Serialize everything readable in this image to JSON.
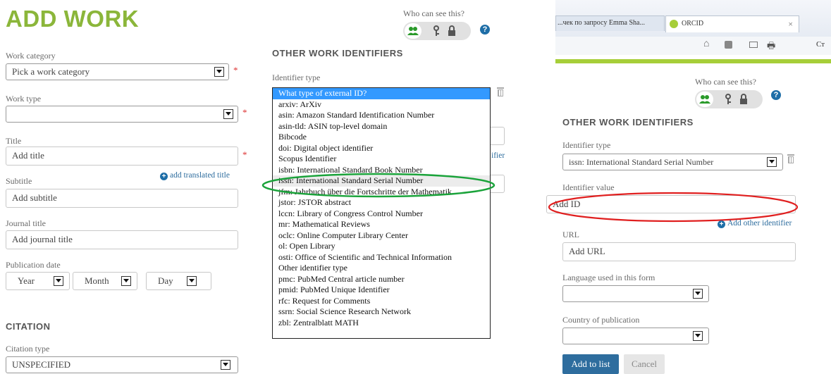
{
  "left": {
    "title": "ADD WORK",
    "who_can_see": "Who can see this?",
    "work_category": {
      "label": "Work category",
      "value": "Pick a work category",
      "required": "*"
    },
    "work_type": {
      "label": "Work type",
      "value": "",
      "required": "*"
    },
    "title_field": {
      "label": "Title",
      "placeholder": "Add title",
      "required": "*"
    },
    "add_translated_title": "add translated title",
    "subtitle": {
      "label": "Subtitle",
      "placeholder": "Add subtitle"
    },
    "journal_title": {
      "label": "Journal title",
      "placeholder": "Add journal title"
    },
    "publication_date": {
      "label": "Publication date",
      "year": "Year",
      "month": "Month",
      "day": "Day"
    },
    "citation_heading": "CITATION",
    "citation_type": {
      "label": "Citation type",
      "value": "UNSPECIFIED"
    }
  },
  "middle": {
    "heading": "OTHER WORK IDENTIFIERS",
    "identifier_type_label": "Identifier type",
    "partial_link": "ifier",
    "options": [
      "What type of external ID?",
      "arxiv: ArXiv",
      "asin: Amazon Standard Identification Number",
      "asin-tld: ASIN top-level domain",
      "Bibcode",
      "doi: Digital object identifier",
      "Scopus Identifier",
      "isbn: International Standard Book Number",
      "issn: International Standard Serial Number",
      "jfm: Jahrbuch über die Fortschritte der Mathematik",
      "jstor: JSTOR abstract",
      "lccn: Library of Congress Control Number",
      "mr: Mathematical Reviews",
      "oclc: Online Computer Library Center",
      "ol: Open Library",
      "osti: Office of Scientific and Technical Information",
      "Other identifier type",
      "pmc: PubMed Central article number",
      "pmid: PubMed Unique Identifier",
      "rfc: Request for Comments",
      "ssrn: Social Science Research Network",
      "zbl: Zentralblatt MATH"
    ],
    "selected_index": 0,
    "highlighted_index": 8
  },
  "right": {
    "browser_tab_text": "...чек по запросу Emma Sha...",
    "browser_tab2": "ORCID",
    "toolbar_partial": "Ст",
    "who_can_see": "Who can see this?",
    "heading": "OTHER WORK IDENTIFIERS",
    "identifier_type": {
      "label": "Identifier type",
      "value": "issn: International Standard Serial Number"
    },
    "identifier_value": {
      "label": "Identifier value",
      "placeholder": "Add ID"
    },
    "add_other_identifier": "Add other identifier",
    "url": {
      "label": "URL",
      "placeholder": "Add URL"
    },
    "language": {
      "label": "Language used in this form",
      "value": ""
    },
    "country": {
      "label": "Country of publication",
      "value": ""
    },
    "add_button": "Add to list",
    "cancel_button": "Cancel"
  },
  "colors": {
    "title_green": "#8bb63a",
    "brand_blue": "#2e6d9e",
    "annotation_green": "#1aa33a",
    "annotation_red": "#e01f1f",
    "selection_blue": "#3399ff"
  }
}
